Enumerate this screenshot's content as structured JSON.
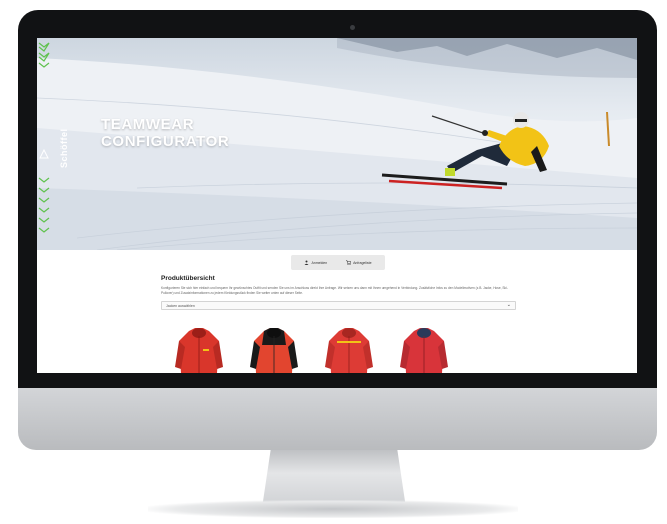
{
  "app": {
    "brand": "Schöffel",
    "hero_title_line1": "TEAMWEAR",
    "hero_title_line2": "CONFIGURATOR"
  },
  "toolbar": {
    "buttons": [
      {
        "label": "Anmelden",
        "icon": "user-icon"
      },
      {
        "label": "Anfrageliste",
        "icon": "cart-icon"
      }
    ]
  },
  "main": {
    "heading": "Produktübersicht",
    "description": "Konfigurieren Sie sich hier einfach und bequem Ihr gewünschtes Outfit und senden Sie uns im Anschluss direkt Ihre Anfrage. Wir setzen uns dann mit Ihnen umgehend in Verbindung. Zusätzliche Infos zu den Modellmotiven (z.B. Jacke, Hose, Ski-Pullover) und Zusatzinformationen zu jedem Kleidungsstück finden Sie weiter unten auf dieser Seite.",
    "select": {
      "value": "Jacken auswählen",
      "chevron": "chevron-down-icon"
    },
    "products": [
      {
        "name": "jacket-red-1",
        "icon": "jacket-icon"
      },
      {
        "name": "jacket-dark",
        "icon": "jacket-icon"
      },
      {
        "name": "jacket-red-2",
        "icon": "jacket-icon"
      },
      {
        "name": "jacket-red-3",
        "icon": "jacket-icon"
      }
    ]
  },
  "colors": {
    "accent_green": "#5fc24d",
    "jacket_red": "#d9362b",
    "skier_yellow": "#f2c316"
  }
}
